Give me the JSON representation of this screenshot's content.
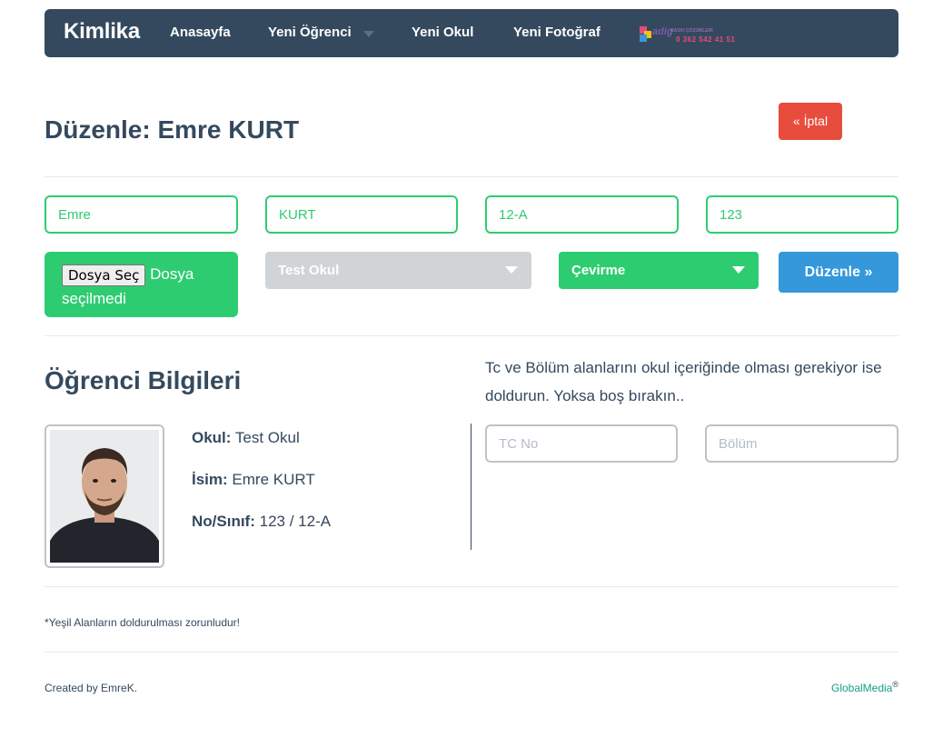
{
  "navbar": {
    "brand": "Kimlika",
    "links": [
      "Anasayfa",
      "Yeni Öğrenci",
      "Yeni Okul",
      "Yeni Fotoğraf"
    ],
    "banner": {
      "word": "adig",
      "tagline": "BASKI ÇÖZÜMLERİ",
      "phone": "0 362 542 41 51"
    }
  },
  "page": {
    "title": "Düzenle: Emre KURT",
    "cancel_label": "« İptal"
  },
  "form": {
    "first_name": "Emre",
    "last_name": "KURT",
    "class": "12-A",
    "number": "123",
    "file_button": "Dosya Seç",
    "file_status": "Dosya seçilmedi",
    "school_select": "Test Okul",
    "rotation_select": "Çevirme",
    "submit_label": "Düzenle »"
  },
  "student": {
    "section_title": "Öğrenci Bilgileri",
    "school_label": "Okul:",
    "school_value": "Test Okul",
    "name_label": "İsim:",
    "name_value": "Emre KURT",
    "noclass_label": "No/Sınıf:",
    "noclass_value": "123 / 12-A"
  },
  "extra": {
    "note": "Tc ve Bölüm alanlarını okul içeriğinde olması gerekiyor ise doldurun. Yoksa boş bırakın..",
    "tc_placeholder": "TC No",
    "department_placeholder": "Bölüm"
  },
  "footer": {
    "required_note": "*Yeşil Alanların doldurulması zorunludur!",
    "created_by": "Created by EmreK.",
    "company": "GlobalMedia",
    "registered": "®"
  },
  "colors": {
    "primary": "#34495e",
    "green": "#2ecc71",
    "red": "#e74c3c",
    "blue": "#3498db",
    "teal": "#16a085"
  }
}
